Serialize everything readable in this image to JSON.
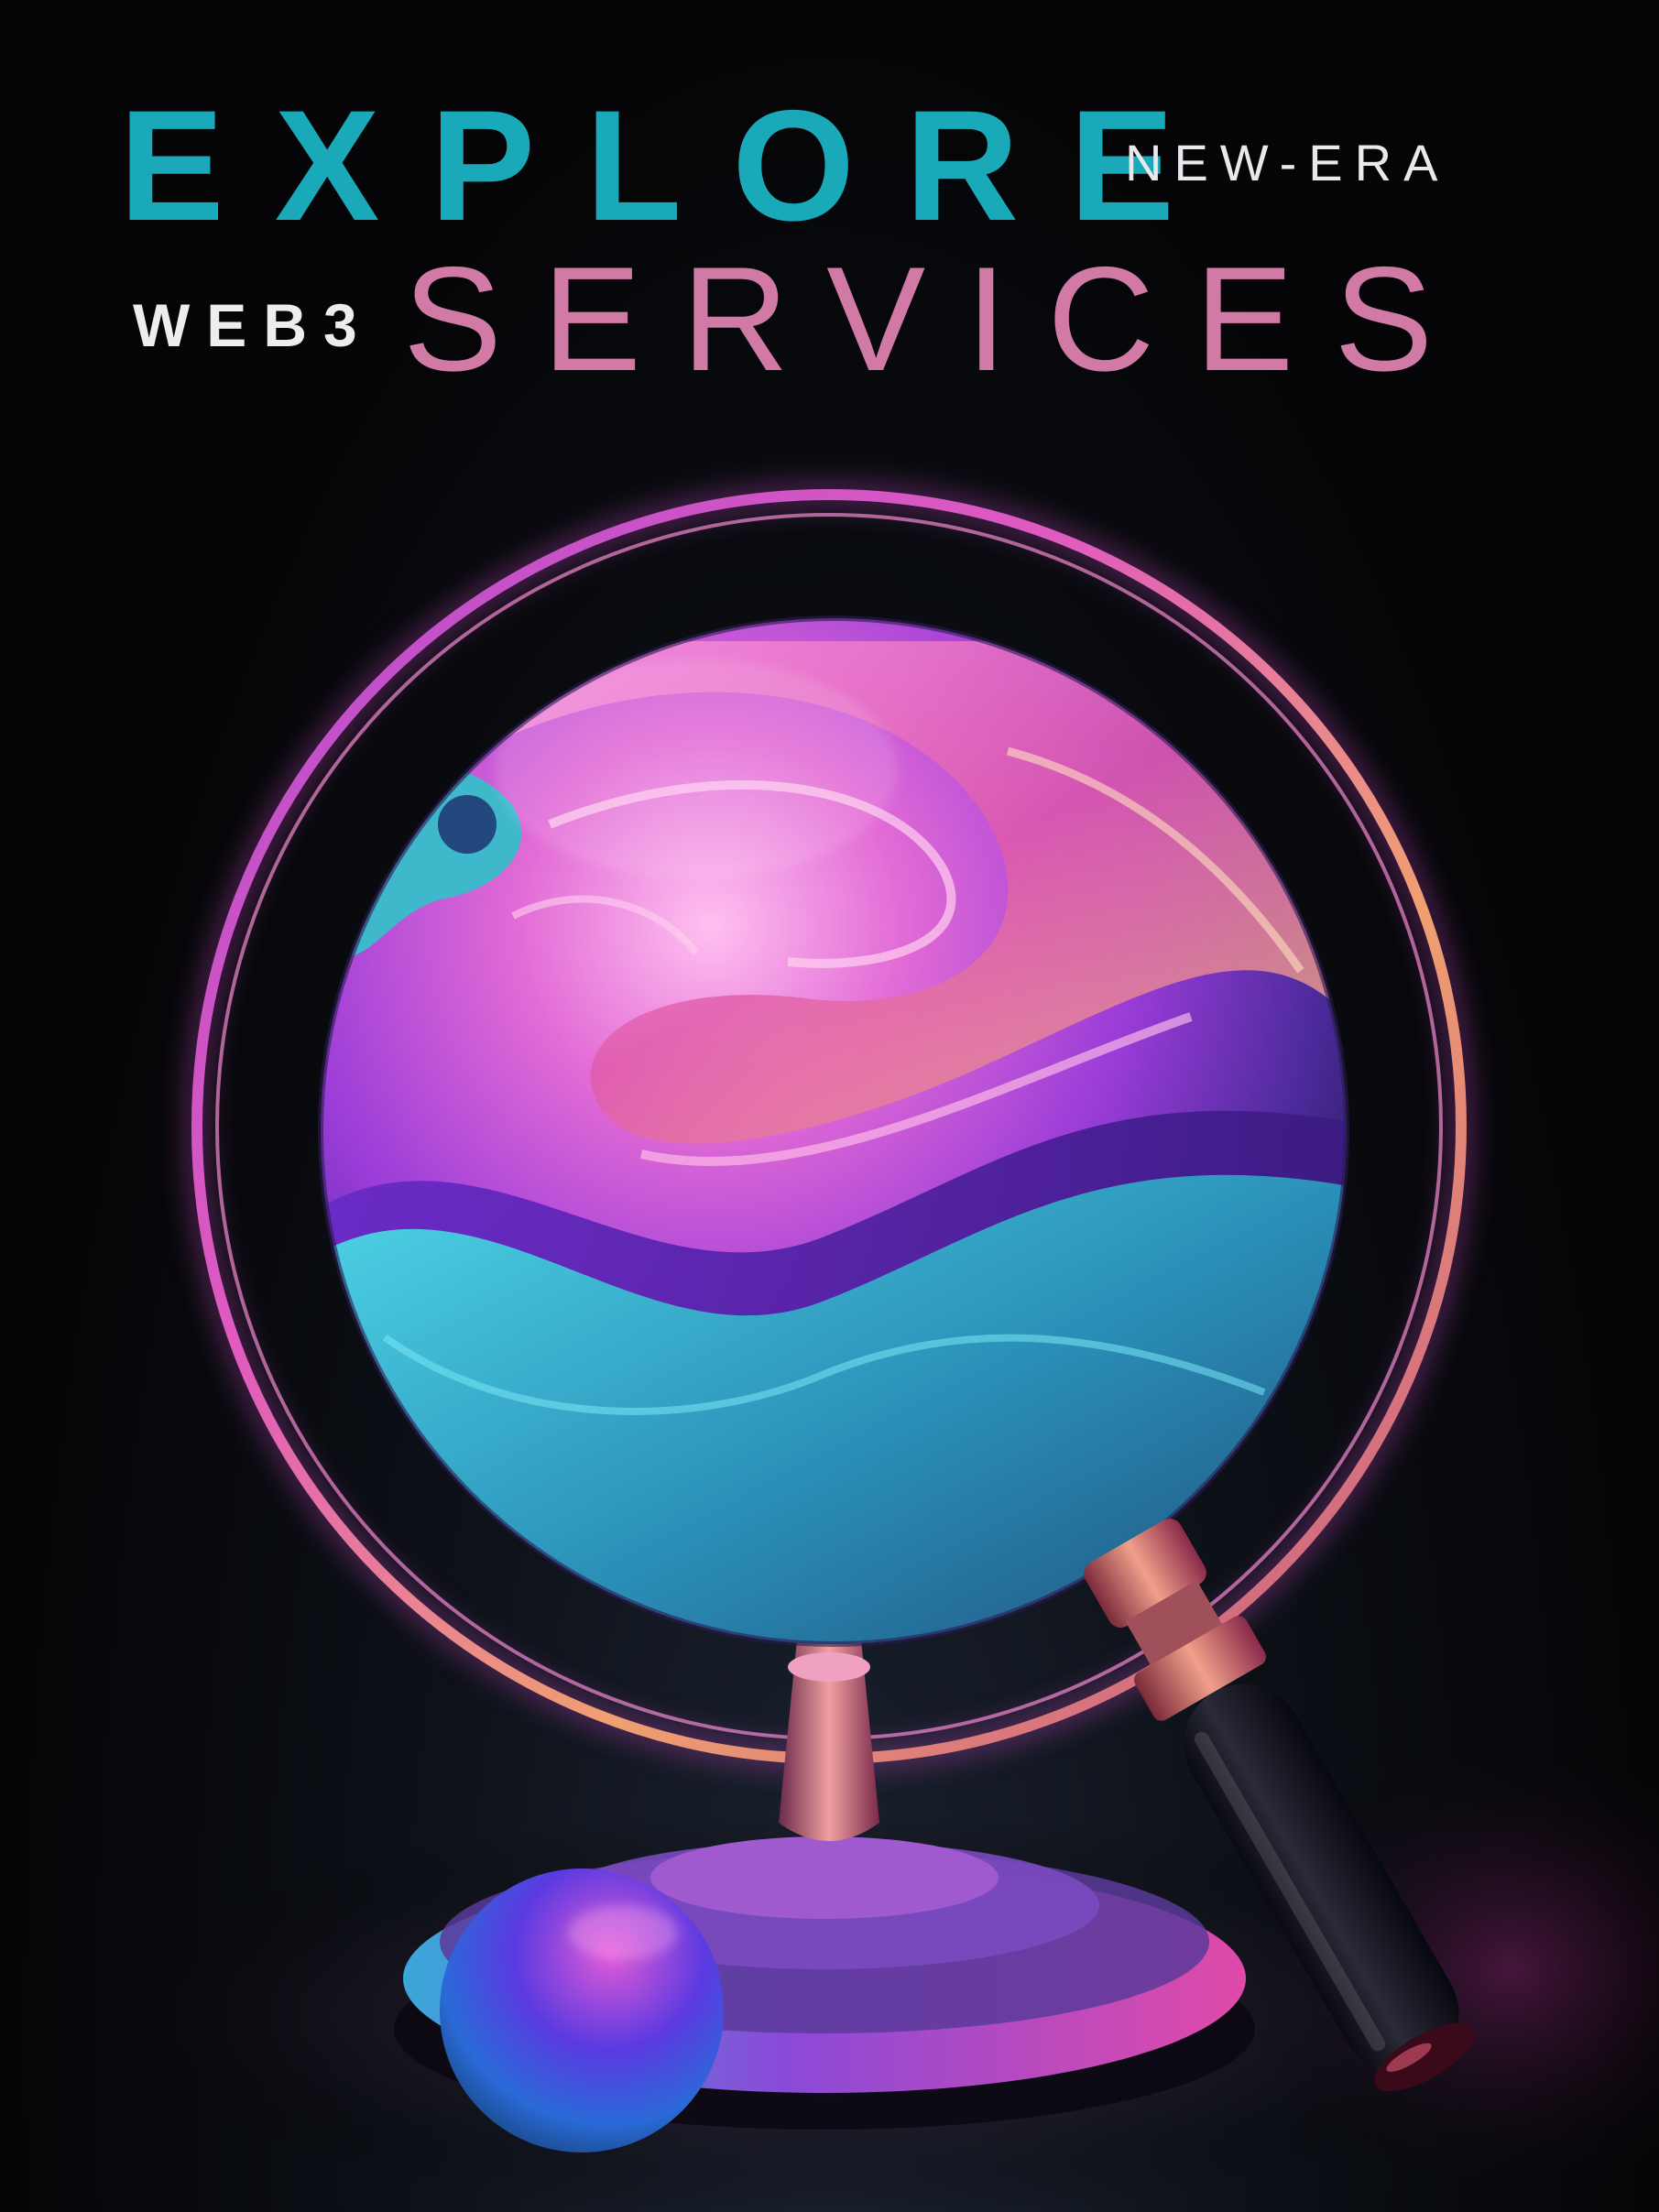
{
  "headline": {
    "explore": "EXPLORE",
    "new_era": "NEW-ERA",
    "web3": "WEB3",
    "services": "SERVICES"
  },
  "colors": {
    "background": "#050507",
    "explore_teal": "#19a9b8",
    "services_pink": "#d27aa6",
    "white_text": "#ededf0"
  },
  "artwork": {
    "subject": "globe-with-magnifying-glass-illustration"
  }
}
